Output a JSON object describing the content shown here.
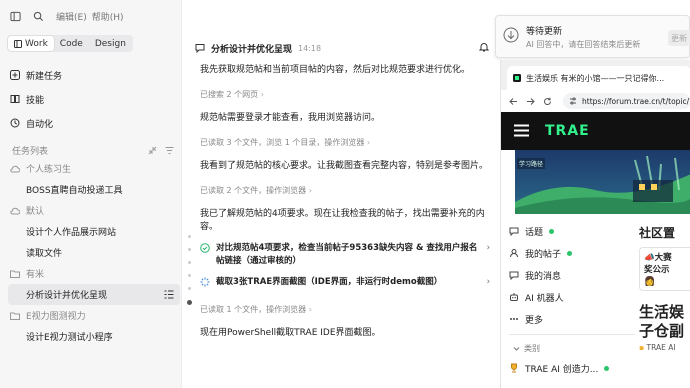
{
  "topbar": {
    "menu": [
      "编辑(E)",
      "帮助(H)"
    ]
  },
  "modes": {
    "items": [
      "Work",
      "Code",
      "Design"
    ],
    "active": "Work"
  },
  "nav": [
    {
      "label": "新建任务",
      "icon": "new-task-icon"
    },
    {
      "label": "技能",
      "icon": "skills-icon"
    },
    {
      "label": "自动化",
      "icon": "automation-icon"
    }
  ],
  "tasks": {
    "header": "任务列表",
    "groups": [
      {
        "name": "个人练习生",
        "items": [
          "BOSS直聘自动投递工具"
        ]
      },
      {
        "name": "默认",
        "items": [
          "设计个人作品展示网站",
          "读取文件"
        ]
      },
      {
        "name": "有米",
        "items": [
          "分析设计并优化呈现"
        ]
      },
      {
        "name": "E视力图测视力",
        "items": [
          "设计E视力测试小程序"
        ]
      }
    ],
    "selected": "分析设计并优化呈现"
  },
  "chat": {
    "title": "分析设计并优化呈现",
    "time": "14:18",
    "msgs": [
      {
        "type": "p",
        "text": "我先获取规范帖和当前项目帖的内容，然后对比规范要求进行优化。"
      },
      {
        "type": "meta",
        "text": "已搜索 2 个网页"
      },
      {
        "type": "p",
        "text": "规范帖需要登录才能查看，我用浏览器访问。"
      },
      {
        "type": "meta",
        "text": "已读取 3 个文件，浏览 1 个目录，操作浏览器"
      },
      {
        "type": "p",
        "text": "我看到了规范帖的核心要求。让我截图查看完整内容，特别是参考图片。"
      },
      {
        "type": "meta",
        "text": "已读取 2 个文件，操作浏览器"
      },
      {
        "type": "p",
        "text": "我已了解规范帖的4项要求。现在让我检查我的帖子，找出需要补充的内容。"
      },
      {
        "type": "step",
        "status": "done",
        "text": "对比规范帖4项要求，检查当前帖子95363缺失内容 & 查找用户报名帖链接（通过审核的）"
      },
      {
        "type": "step",
        "status": "running",
        "text": "截取3张TRAE界面截图（IDE界面，非运行时demo截图）"
      },
      {
        "type": "meta",
        "text": "已读取 1 个文件，操作浏览器"
      },
      {
        "type": "p",
        "text": "现在用PowerShell截取TRAE IDE界面截图。"
      }
    ]
  },
  "notif": {
    "title": "等待更新",
    "subtitle": "AI 回答中，请在回答结束后更新",
    "button": "更新"
  },
  "browser": {
    "tab": "生活娱乐 有米的小馆——一只记得你...",
    "url": "https://forum.trae.cn/t/topic/73038",
    "logo": "TRAE",
    "banner_text": "学习路径",
    "nav": [
      {
        "label": "话题",
        "dot": true,
        "icon": "topics-icon"
      },
      {
        "label": "我的帖子",
        "dot": true,
        "icon": "my-posts-icon"
      },
      {
        "label": "我的消息",
        "dot": false,
        "icon": "messages-icon"
      },
      {
        "label": "AI 机器人",
        "dot": false,
        "icon": "ai-bot-icon"
      },
      {
        "label": "更多",
        "dot": false,
        "icon": "more-icon"
      }
    ],
    "category_header": "类别",
    "category": "TRAE AI 创造力...",
    "right_title": "社区置",
    "card_line1": "大赛",
    "card_line2": "奖公示",
    "big_line1": "生活娱",
    "big_line2": "子仓副",
    "tag": "TRAE AI"
  }
}
